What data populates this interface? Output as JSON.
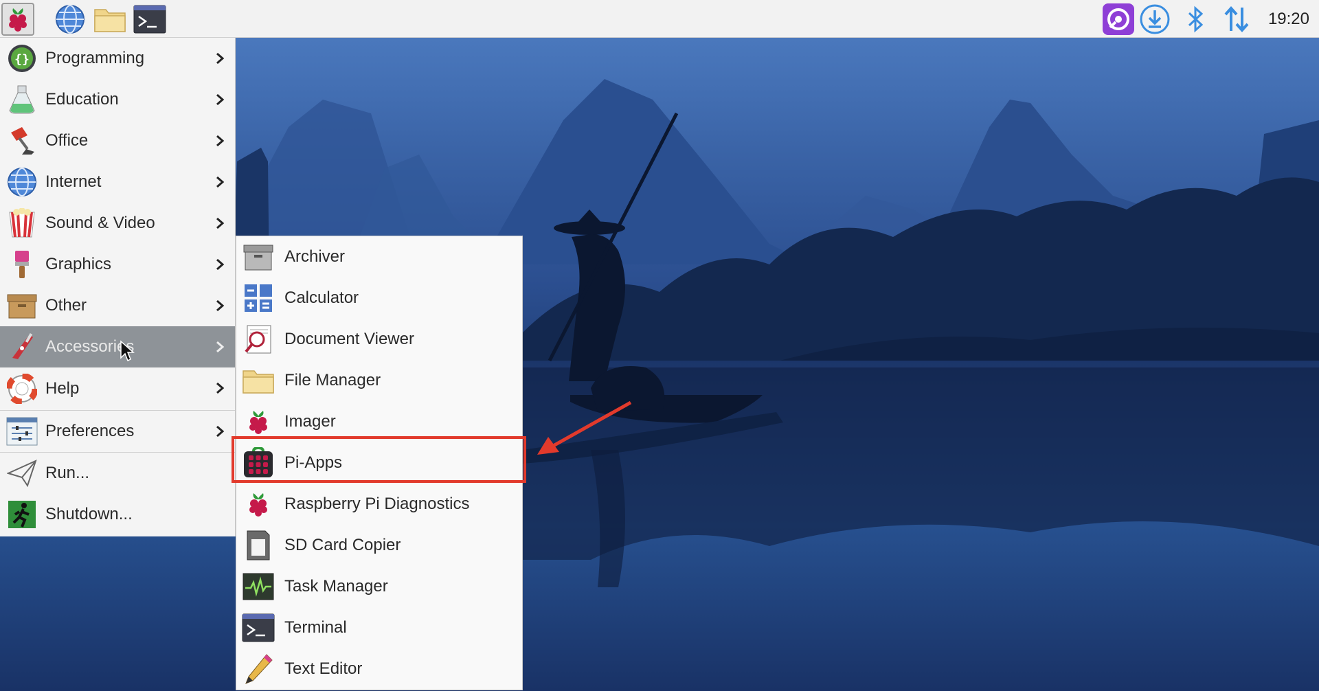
{
  "panel": {
    "clock": "19:20",
    "launchers": [
      "raspberry-menu-icon",
      "web-browser-icon",
      "file-manager-icon",
      "terminal-icon"
    ],
    "tray": [
      "pi-apps-tray-icon",
      "updater-icon",
      "bluetooth-icon",
      "network-icon"
    ]
  },
  "main_menu": {
    "items": [
      {
        "label": "Programming",
        "icon": "programming-icon"
      },
      {
        "label": "Education",
        "icon": "education-icon"
      },
      {
        "label": "Office",
        "icon": "office-icon"
      },
      {
        "label": "Internet",
        "icon": "internet-icon"
      },
      {
        "label": "Sound & Video",
        "icon": "sound-video-icon"
      },
      {
        "label": "Graphics",
        "icon": "graphics-icon"
      },
      {
        "label": "Other",
        "icon": "other-icon"
      },
      {
        "label": "Accessories",
        "icon": "accessories-icon",
        "active": true
      },
      {
        "label": "Help",
        "icon": "help-icon"
      },
      {
        "label": "Preferences",
        "icon": "preferences-icon"
      },
      {
        "label": "Run...",
        "icon": "run-icon"
      },
      {
        "label": "Shutdown...",
        "icon": "shutdown-icon"
      }
    ]
  },
  "accessories_menu": {
    "items": [
      {
        "label": "Archiver",
        "icon": "archiver-icon"
      },
      {
        "label": "Calculator",
        "icon": "calculator-icon"
      },
      {
        "label": "Document Viewer",
        "icon": "document-viewer-icon"
      },
      {
        "label": "File Manager",
        "icon": "folder-icon"
      },
      {
        "label": "Imager",
        "icon": "imager-icon"
      },
      {
        "label": "Pi-Apps",
        "icon": "pi-apps-icon",
        "highlighted": true
      },
      {
        "label": "Raspberry Pi Diagnostics",
        "icon": "diagnostics-icon"
      },
      {
        "label": "SD Card Copier",
        "icon": "sd-card-icon"
      },
      {
        "label": "Task Manager",
        "icon": "task-manager-icon"
      },
      {
        "label": "Terminal",
        "icon": "terminal-icon"
      },
      {
        "label": "Text Editor",
        "icon": "text-editor-icon"
      }
    ]
  },
  "colors": {
    "highlight_border": "#e23a2c",
    "active_menu_bg": "#8e9398",
    "panel_bg": "#f2f2f2"
  }
}
